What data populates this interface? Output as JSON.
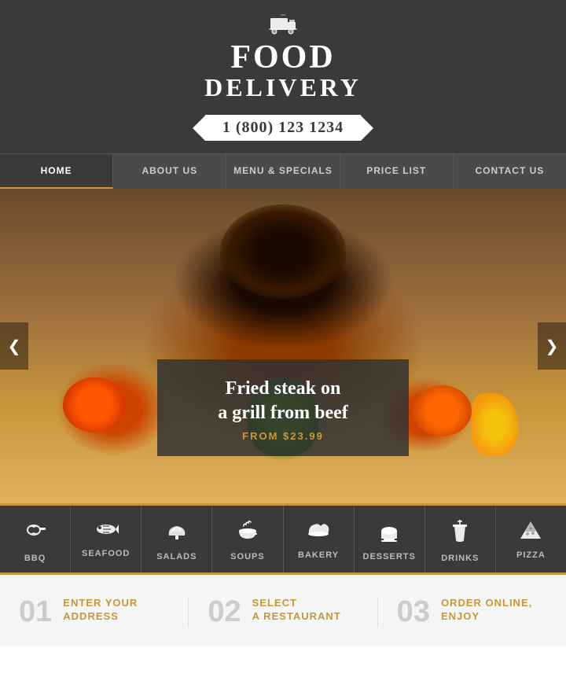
{
  "header": {
    "truck_icon": "🚚",
    "title_food": "FOOD",
    "title_delivery": "DELIVERY",
    "phone": "1 (800) 123 1234"
  },
  "nav": {
    "items": [
      {
        "label": "HOME",
        "active": true
      },
      {
        "label": "ABOUT US",
        "active": false
      },
      {
        "label": "MENU & SPECIALS",
        "active": false
      },
      {
        "label": "PRICE LIST",
        "active": false
      },
      {
        "label": "CONTACT US",
        "active": false
      }
    ]
  },
  "hero": {
    "arrows": {
      "left": "❮",
      "right": "❯"
    },
    "caption": {
      "title_line1": "Fried steak on",
      "title_line2": "a grill from beef",
      "price": "FROM $23.99"
    }
  },
  "categories": [
    {
      "icon": "🍖",
      "label": "BBQ"
    },
    {
      "icon": "🐟",
      "label": "SEAFOOD"
    },
    {
      "icon": "🥗",
      "label": "SALADS"
    },
    {
      "icon": "🍜",
      "label": "SOUPS"
    },
    {
      "icon": "🥐",
      "label": "BAKERY"
    },
    {
      "icon": "🎂",
      "label": "DESSERTS"
    },
    {
      "icon": "🍹",
      "label": "DRINKS"
    },
    {
      "icon": "🍕",
      "label": "PIZZA"
    }
  ],
  "steps": [
    {
      "number": "01",
      "title_line1": "ENTER YOUR",
      "title_line2": "ADDRESS"
    },
    {
      "number": "02",
      "title_line1": "SELECT",
      "title_line2": "A RESTAURANT"
    },
    {
      "number": "03",
      "title_line1": "ORDER ONLINE,",
      "title_line2": "ENJOY"
    }
  ]
}
